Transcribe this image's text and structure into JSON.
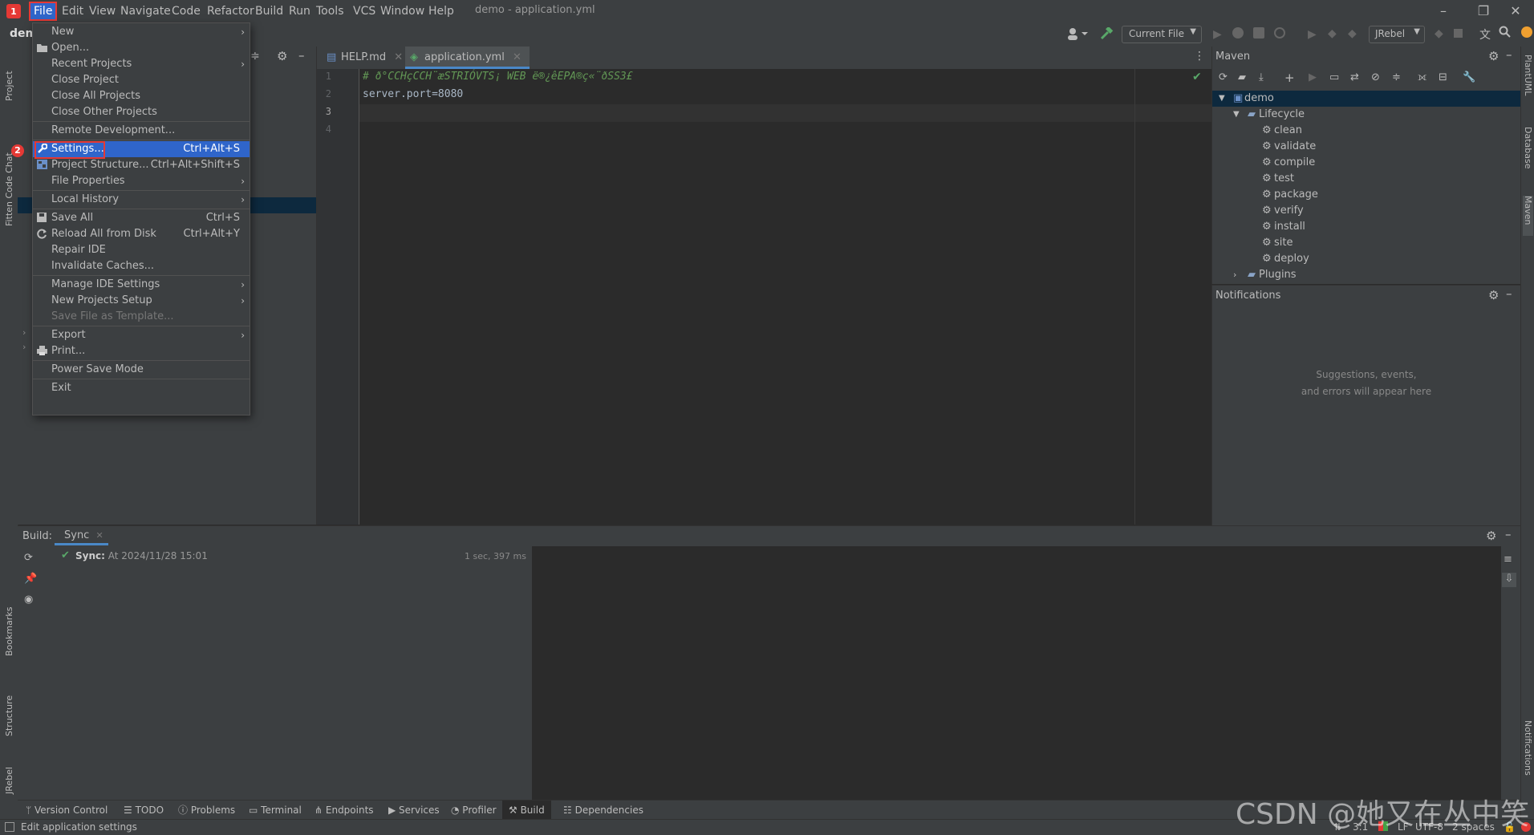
{
  "window": {
    "title": "demo - application.yml",
    "menu": [
      "File",
      "Edit",
      "View",
      "Navigate",
      "Code",
      "Refactor",
      "Build",
      "Run",
      "Tools",
      "VCS",
      "Window",
      "Help"
    ]
  },
  "toolbar": {
    "project_short": "dem",
    "run_config": "Current File",
    "jrebel": "JRebel"
  },
  "badges": {
    "menu_badge": "1",
    "settings_badge": "2"
  },
  "file_menu": {
    "items": [
      {
        "label": "New",
        "shortcut": "",
        "submenu": true
      },
      {
        "label": "Open...",
        "shortcut": "",
        "submenu": false
      },
      {
        "label": "Recent Projects",
        "shortcut": "",
        "submenu": true
      },
      {
        "label": "Close Project",
        "shortcut": "",
        "submenu": false
      },
      {
        "label": "Close All Projects",
        "shortcut": "",
        "submenu": false
      },
      {
        "label": "Close Other Projects",
        "shortcut": "",
        "submenu": false
      },
      {
        "label": "Remote Development...",
        "shortcut": "",
        "submenu": false
      },
      {
        "label": "Settings...",
        "shortcut": "Ctrl+Alt+S",
        "submenu": false,
        "selected": true
      },
      {
        "label": "Project Structure...",
        "shortcut": "Ctrl+Alt+Shift+S",
        "submenu": false
      },
      {
        "label": "File Properties",
        "shortcut": "",
        "submenu": true
      },
      {
        "label": "Local History",
        "shortcut": "",
        "submenu": true
      },
      {
        "label": "Save All",
        "shortcut": "Ctrl+S",
        "submenu": false
      },
      {
        "label": "Reload All from Disk",
        "shortcut": "Ctrl+Alt+Y",
        "submenu": false
      },
      {
        "label": "Repair IDE",
        "shortcut": "",
        "submenu": false
      },
      {
        "label": "Invalidate Caches...",
        "shortcut": "",
        "submenu": false
      },
      {
        "label": "Manage IDE Settings",
        "shortcut": "",
        "submenu": true
      },
      {
        "label": "New Projects Setup",
        "shortcut": "",
        "submenu": true
      },
      {
        "label": "Save File as Template...",
        "shortcut": "",
        "submenu": false,
        "disabled": true
      },
      {
        "label": "Export",
        "shortcut": "",
        "submenu": true
      },
      {
        "label": "Print...",
        "shortcut": "",
        "submenu": false
      },
      {
        "label": "Power Save Mode",
        "shortcut": "",
        "submenu": false
      },
      {
        "label": "Exit",
        "shortcut": "",
        "submenu": false
      }
    ]
  },
  "left_stripe": {
    "project": "Project",
    "fitten": "Fitten Code Chat",
    "bookmarks": "Bookmarks",
    "structure": "Structure",
    "jrebel": "JRebel"
  },
  "editor": {
    "tabs": [
      {
        "label": "HELP.md"
      },
      {
        "label": "application.yml",
        "active": true
      }
    ],
    "lines": [
      {
        "no": "1",
        "text": "# ð°CCHçCCH¨æSTRIÓVTS¡ WEB ë®¿êEPA®ç«¨ðSS3£",
        "kind": "comment"
      },
      {
        "no": "2",
        "text": "server.port=8080",
        "kind": "code"
      },
      {
        "no": "3",
        "text": "",
        "kind": "code"
      },
      {
        "no": "4",
        "text": "",
        "kind": "code"
      }
    ]
  },
  "maven": {
    "title": "Maven",
    "root": "demo",
    "lifecycle_label": "Lifecycle",
    "lifecycle": [
      "clean",
      "validate",
      "compile",
      "test",
      "package",
      "verify",
      "install",
      "site",
      "deploy"
    ],
    "plugins_label": "Plugins"
  },
  "notifications": {
    "title": "Notifications",
    "empty_line1": "Suggestions, events,",
    "empty_line2": "and errors will appear here"
  },
  "right_stripe": {
    "plantuml": "PlantUML",
    "database": "Database",
    "maven": "Maven",
    "notifications": "Notifications"
  },
  "build": {
    "label": "Build:",
    "tab": "Sync",
    "sync_title": "Sync:",
    "sync_time": "At 2024/11/28 15:01",
    "duration": "1 sec, 397 ms"
  },
  "bottom_tools": [
    "Version Control",
    "TODO",
    "Problems",
    "Terminal",
    "Endpoints",
    "Services",
    "Profiler",
    "Build",
    "Dependencies"
  ],
  "statusbar": {
    "message": "Edit application settings",
    "position": "3:1",
    "line_sep": "LF",
    "encoding": "UTF-8",
    "indent": "2 spaces"
  },
  "watermark": "CSDN @她又在丛中笑",
  "colors": {
    "accent": "#2f65ca",
    "highlight": "#e53935",
    "success": "#59a869"
  }
}
